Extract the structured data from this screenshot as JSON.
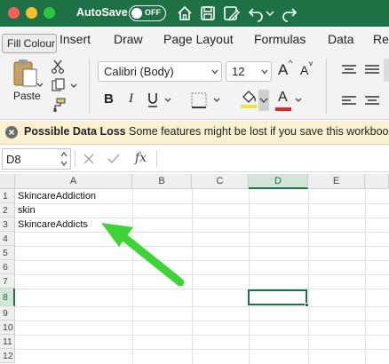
{
  "titlebar": {
    "autosave_label": "AutoSave",
    "autosave_state": "OFF",
    "icons": [
      "home-icon",
      "save-icon",
      "save-as-icon",
      "undo-icon",
      "redo-icon"
    ]
  },
  "tooltip": "Fill Colour",
  "tabs": [
    "Insert",
    "Draw",
    "Page Layout",
    "Formulas",
    "Data",
    "Re"
  ],
  "ribbon": {
    "paste_label": "Paste",
    "font_name": "Calibri (Body)",
    "font_size": "12",
    "bold": "B",
    "italic": "I",
    "font_grow": "A",
    "font_shrink": "A",
    "font_color_letter": "A",
    "fill_color": "#f5e23b",
    "font_color": "#e0262b"
  },
  "notification": {
    "title": "Possible Data Loss",
    "message": "Some features might be lost if you save this workbook"
  },
  "formula_bar": {
    "name_box": "D8",
    "fx_label": "fx",
    "formula": ""
  },
  "grid": {
    "columns": [
      "A",
      "B",
      "C",
      "D",
      "E"
    ],
    "selected_column": "D",
    "rows": [
      "1",
      "2",
      "3",
      "4",
      "5",
      "6",
      "7",
      "8",
      "9",
      "10",
      "11",
      "12"
    ],
    "selected_row": "8",
    "cells": {
      "A1": "SkincareAddiction",
      "A2": "skin",
      "A3": "SkincareAddicts"
    }
  },
  "annotation": {
    "arrow_color": "#3fd33a"
  }
}
